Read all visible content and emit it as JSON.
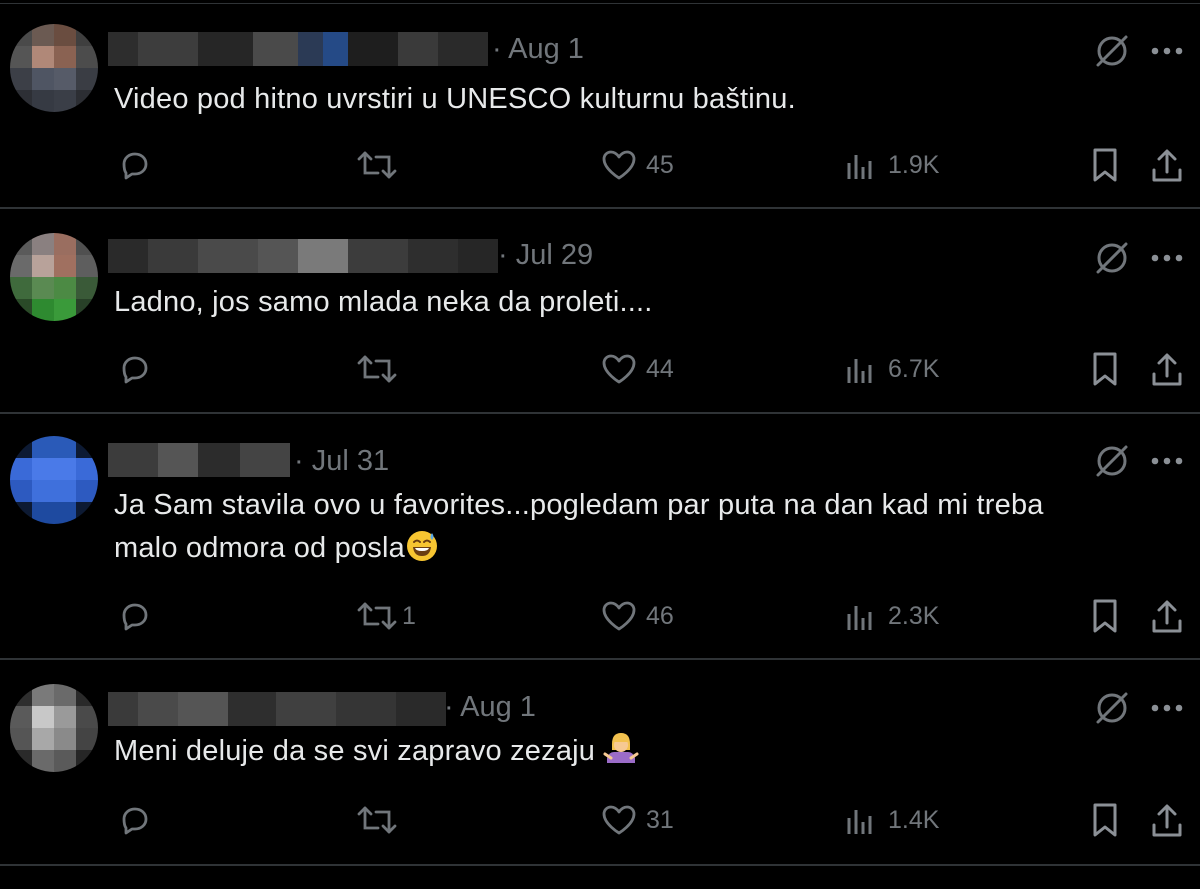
{
  "replies": [
    {
      "date": "· Aug 1",
      "text": "Video pod hitno uvrstiri u UNESCO kulturnu baštinu.",
      "retweets": "",
      "likes": "45",
      "views": "1.9K"
    },
    {
      "date": "· Jul 29",
      "text": "Ladno, jos samo mlada neka da proleti....",
      "retweets": "",
      "likes": "44",
      "views": "6.7K"
    },
    {
      "date": "· Jul 31",
      "text_line1": "Ja Sam stavila ovo u favorites...pogledam par puta na dan kad mi treba",
      "text_line2": "malo odmora od posla",
      "retweets": "1",
      "likes": "46",
      "views": "2.3K"
    },
    {
      "date": "· Aug 1",
      "text": "Meni deluje da se svi zapravo zezaju",
      "retweets": "",
      "likes": "31",
      "views": "1.4K"
    }
  ],
  "icons": {
    "reply": "reply-icon",
    "retweet": "retweet-icon",
    "like": "heart-icon",
    "views": "views-icon",
    "bookmark": "bookmark-icon",
    "share": "share-icon",
    "grok": "grok-icon",
    "more": "more-icon"
  },
  "colors": {
    "background": "#000000",
    "text": "#e7e9ea",
    "muted": "#71767b",
    "divider": "#2f3336"
  }
}
